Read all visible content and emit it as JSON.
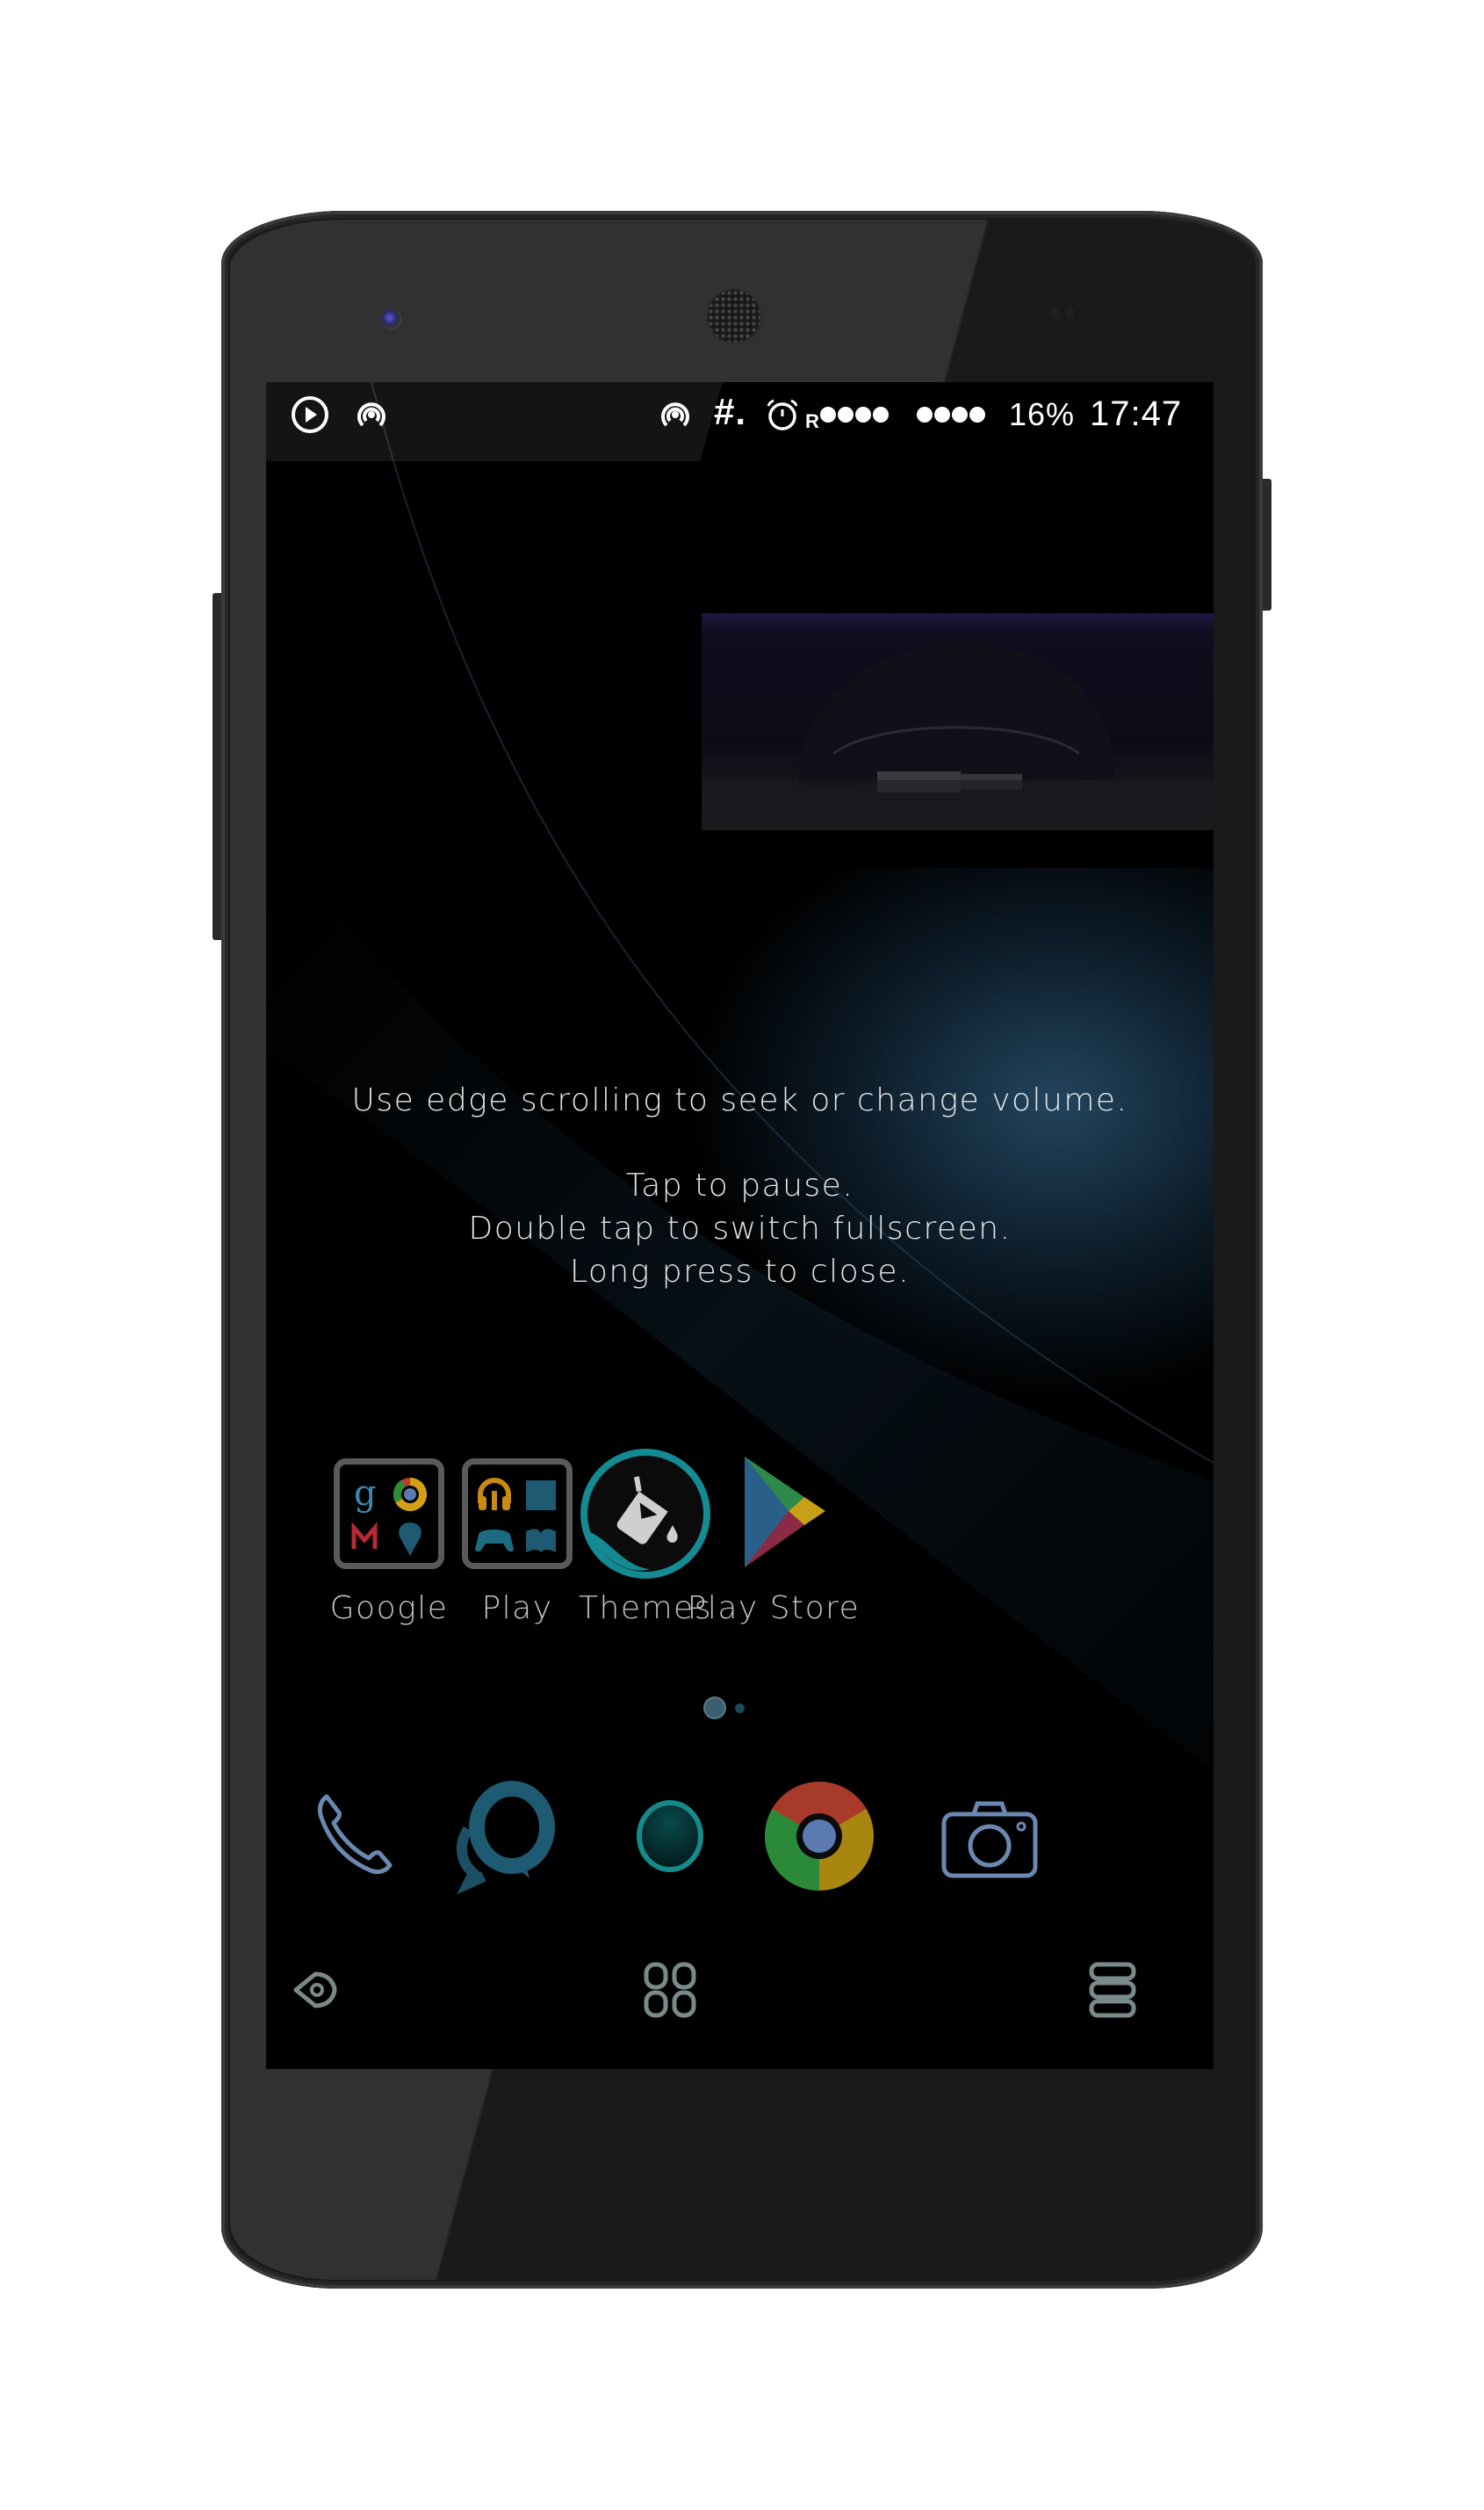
{
  "status_bar": {
    "left_icons": [
      "play-circle-icon",
      "hotspot-icon"
    ],
    "right_icons": [
      "hotspot-icon",
      "hash-icon",
      "alarm-icon"
    ],
    "roaming_label": "R",
    "signal_1_dots": 4,
    "signal_2_dots": 4,
    "battery": "16%",
    "time": "17:47"
  },
  "video_popup": {
    "caption": "",
    "hint_lines": [
      "Use edge scrolling to seek or change volume.",
      "Tap to pause.",
      "Double tap to switch fullscreen.",
      "Long press to close."
    ]
  },
  "home": {
    "apps": [
      {
        "label": "Google",
        "icon": "google-folder-icon"
      },
      {
        "label": "Play",
        "icon": "play-folder-icon"
      },
      {
        "label": "Themes",
        "icon": "themes-icon"
      },
      {
        "label": "Play Store",
        "icon": "play-store-icon"
      }
    ],
    "page_indicator": {
      "pages": 2,
      "current": 1
    }
  },
  "dock": [
    {
      "name": "phone",
      "icon": "phone-icon"
    },
    {
      "name": "messenger",
      "icon": "messenger-icon"
    },
    {
      "name": "launcher",
      "icon": "circle-icon"
    },
    {
      "name": "chrome",
      "icon": "chrome-icon"
    },
    {
      "name": "camera",
      "icon": "camera-icon"
    }
  ],
  "navigation": [
    {
      "name": "back",
      "icon": "back-icon"
    },
    {
      "name": "home",
      "icon": "home-grid-icon"
    },
    {
      "name": "recents",
      "icon": "recents-icon"
    }
  ],
  "colors": {
    "accent_teal": "#1a8a8f",
    "icon_blue": "#6a88b0",
    "folder_border": "#5a5a5a",
    "label_gray": "#c4c4c4"
  }
}
